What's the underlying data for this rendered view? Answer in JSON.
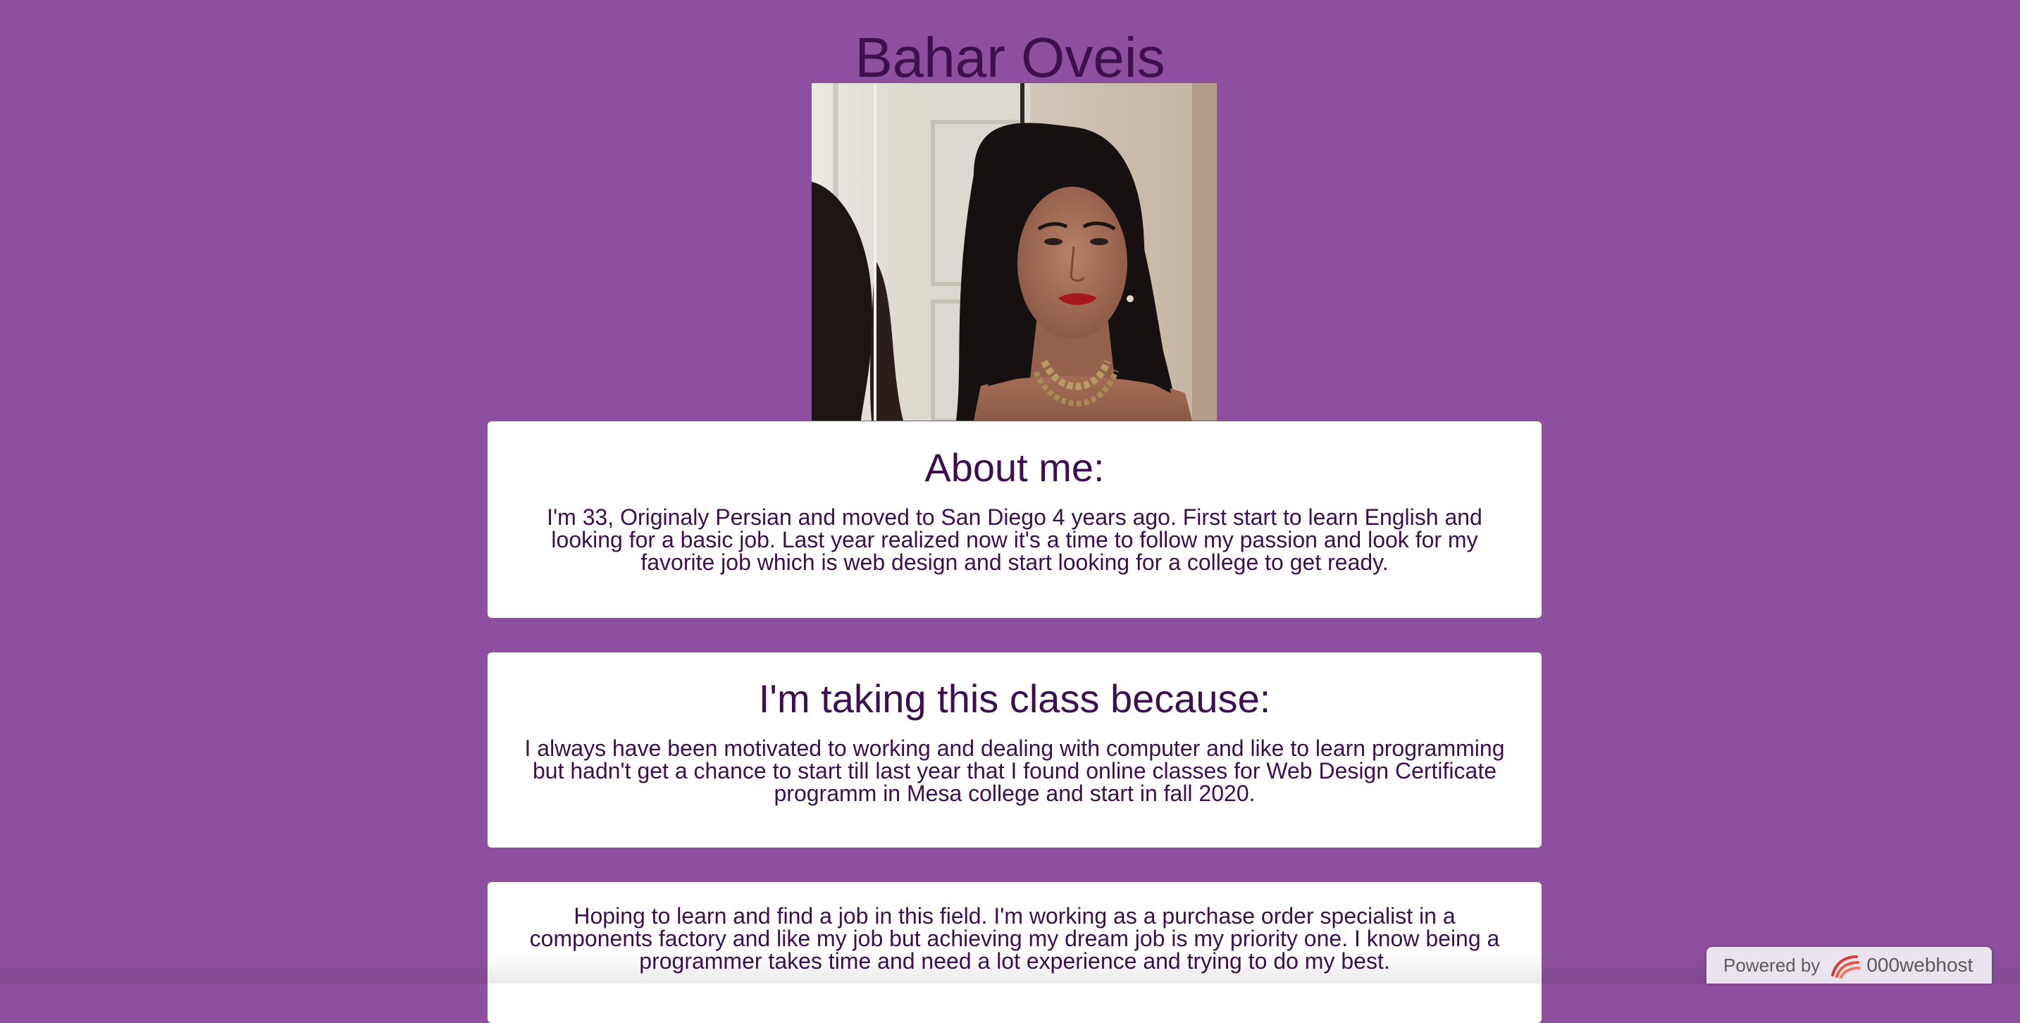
{
  "header": {
    "title": "Bahar Oveis"
  },
  "profile": {
    "photo_icon": "portrait-photo"
  },
  "sections": {
    "about": {
      "heading": "About me:",
      "body": "I'm 33, Originaly Persian and moved to San Diego 4 years ago. First start to learn English and looking for a basic job. Last year realized now it's a time to follow my passion and look for my favorite job which is web design and start looking for a college to get ready."
    },
    "class": {
      "heading": "I'm taking this class because:",
      "body": "I always have been motivated to working and dealing with computer and like to learn programming but hadn't get a chance to start till last year that I found online classes for Web Design Certificate programm in Mesa college and start in fall 2020."
    },
    "hope": {
      "body": "Hoping to learn and find a job in this field. I'm working as a purchase order specialist in a components factory and like my job but achieving my dream job is my priority one. I know being a programmer takes time and need a lot experience and trying to do my best."
    }
  },
  "badge": {
    "powered_by": "Powered by",
    "brand": "000webhost",
    "logo_icon": "000webhost-logo"
  },
  "colors": {
    "background": "#8d4f9f",
    "text": "#3c0f4f",
    "card": "#ffffff"
  }
}
